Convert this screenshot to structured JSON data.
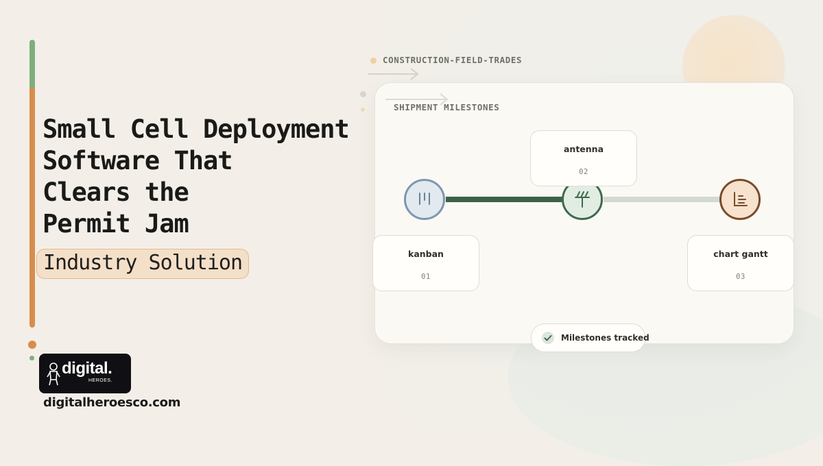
{
  "headline": {
    "line1": "Small Cell Deployment",
    "line2": "Software That",
    "line3": "Clears the",
    "line4": "Permit Jam"
  },
  "tag": "Industry Solution",
  "brand": {
    "logo_text": "digital.",
    "logo_sub": "HEROES.",
    "url": "digitalheroesco.com"
  },
  "category": "CONSTRUCTION-FIELD-TRADES",
  "panel": {
    "title": "SHIPMENT MILESTONES",
    "progress_fraction": 0.5,
    "steps": [
      {
        "name": "kanban",
        "number": "01",
        "icon": "kanban-icon"
      },
      {
        "name": "antenna",
        "number": "02",
        "icon": "antenna-icon"
      },
      {
        "name": "chart gantt",
        "number": "03",
        "icon": "chart-gantt-icon"
      }
    ],
    "status": "Milestones tracked"
  },
  "colors": {
    "accent_orange": "#d98d4d",
    "accent_green": "#7fae7e",
    "track_done": "#3d6249",
    "track_todo": "#d3d8d0"
  }
}
